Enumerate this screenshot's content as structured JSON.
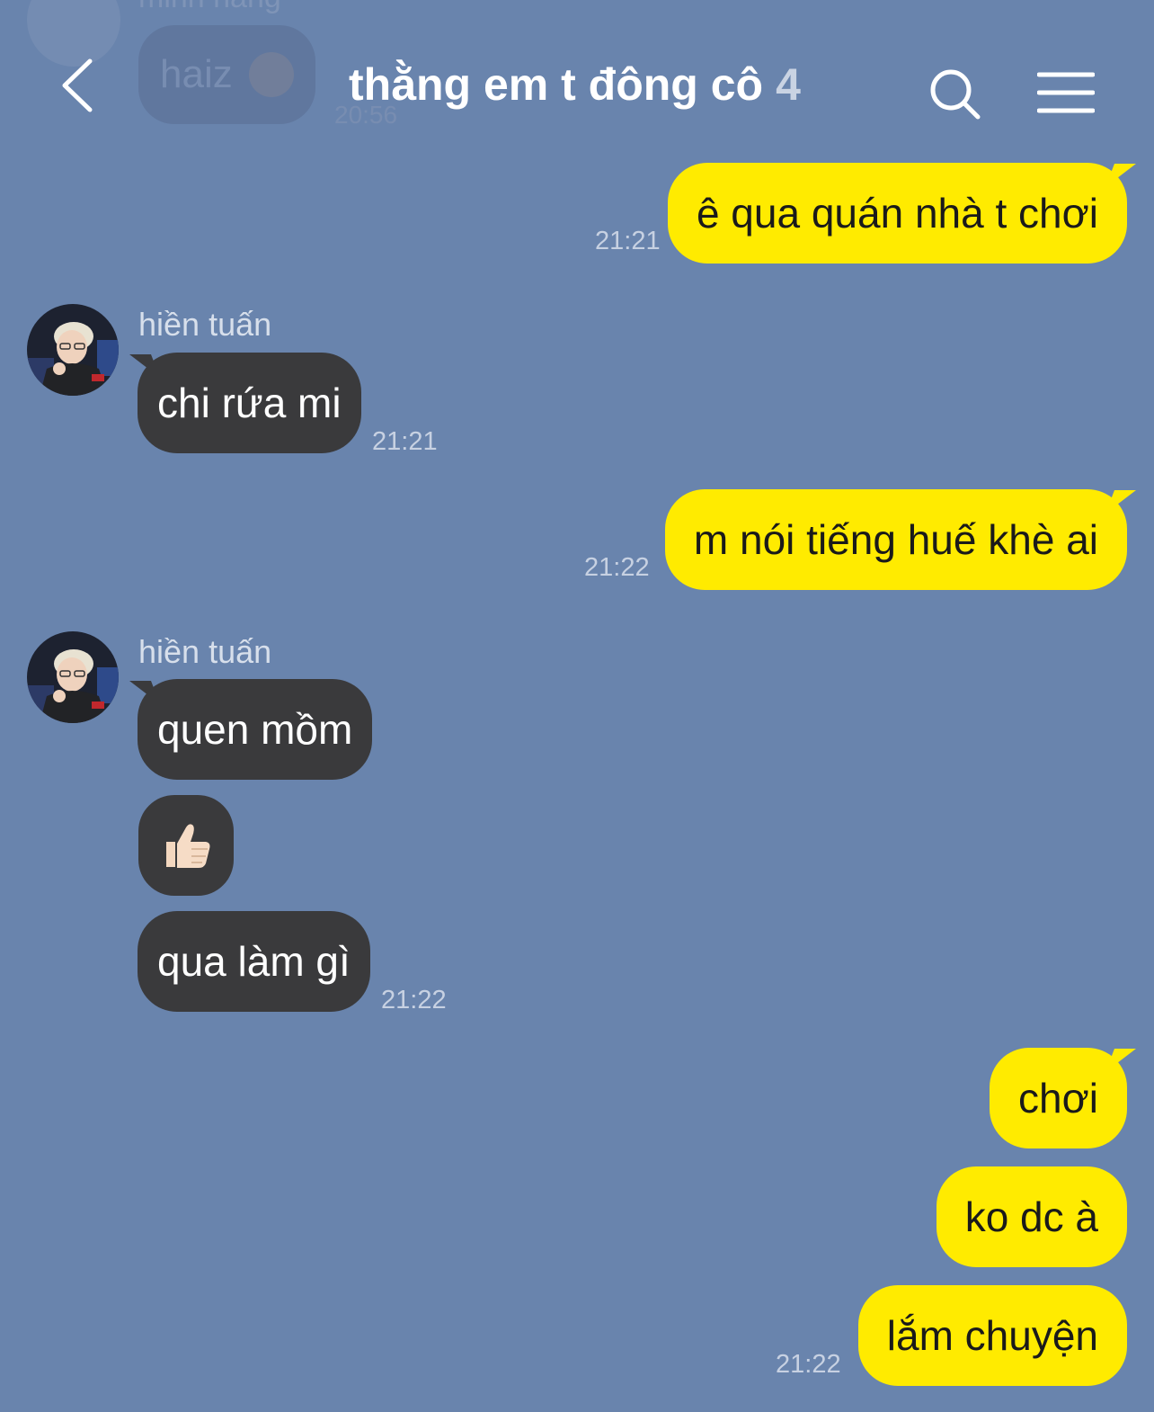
{
  "header": {
    "title": "thằng em t đông cô",
    "member_count": "4"
  },
  "faded_message": {
    "sender": "minh hằng",
    "text": "haiz",
    "time": "20:56"
  },
  "messages": {
    "m1": {
      "text": "ê qua quán nhà t chơi",
      "time": "21:21"
    },
    "m2": {
      "sender": "hiền tuấn",
      "text": "chi rứa mi",
      "time": "21:21"
    },
    "m3": {
      "text": "m nói tiếng huế khè ai",
      "time": "21:22"
    },
    "m4": {
      "sender": "hiền tuấn",
      "text": "quen mồm"
    },
    "m5": {
      "emoji": "thumbs-up"
    },
    "m6": {
      "text": "qua làm gì",
      "time": "21:22"
    },
    "m7": {
      "text": "chơi"
    },
    "m8": {
      "text": "ko dc à"
    },
    "m9": {
      "text": "lắm chuyện",
      "time": "21:22"
    }
  },
  "colors": {
    "background": "#6984ad",
    "outgoing_bubble": "#ffeb00",
    "incoming_bubble": "#3a3a3c"
  },
  "icons": [
    "back-arrow-icon",
    "search-icon",
    "menu-icon",
    "thumbs-up-icon",
    "avatar"
  ]
}
